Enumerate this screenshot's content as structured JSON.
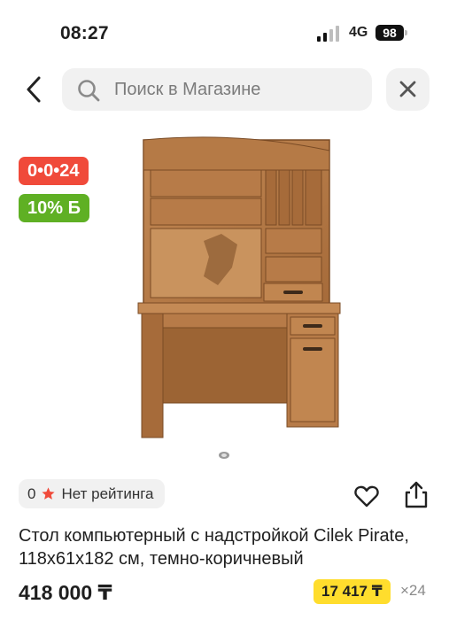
{
  "status_bar": {
    "time": "08:27",
    "network": "4G",
    "battery": "98"
  },
  "search": {
    "placeholder": "Поиск в Магазине"
  },
  "badges": {
    "timer": "0•0•24",
    "discount": "10% Б"
  },
  "rating": {
    "count": "0",
    "label": "Нет рейтинга"
  },
  "product": {
    "title": "Стол компьютерный с надстройкой Cilek Pirate, 118x61x182 см, темно-коричневый",
    "price": "418 000 ₸",
    "installment_price": "17 417 ₸",
    "installment_months": "×24"
  },
  "gallery": {
    "current": 1,
    "total": 1
  },
  "colors": {
    "timer_badge": "#f04a3a",
    "discount_badge": "#5fb024",
    "installment": "#ffdd2d",
    "star": "#f04a3a"
  }
}
